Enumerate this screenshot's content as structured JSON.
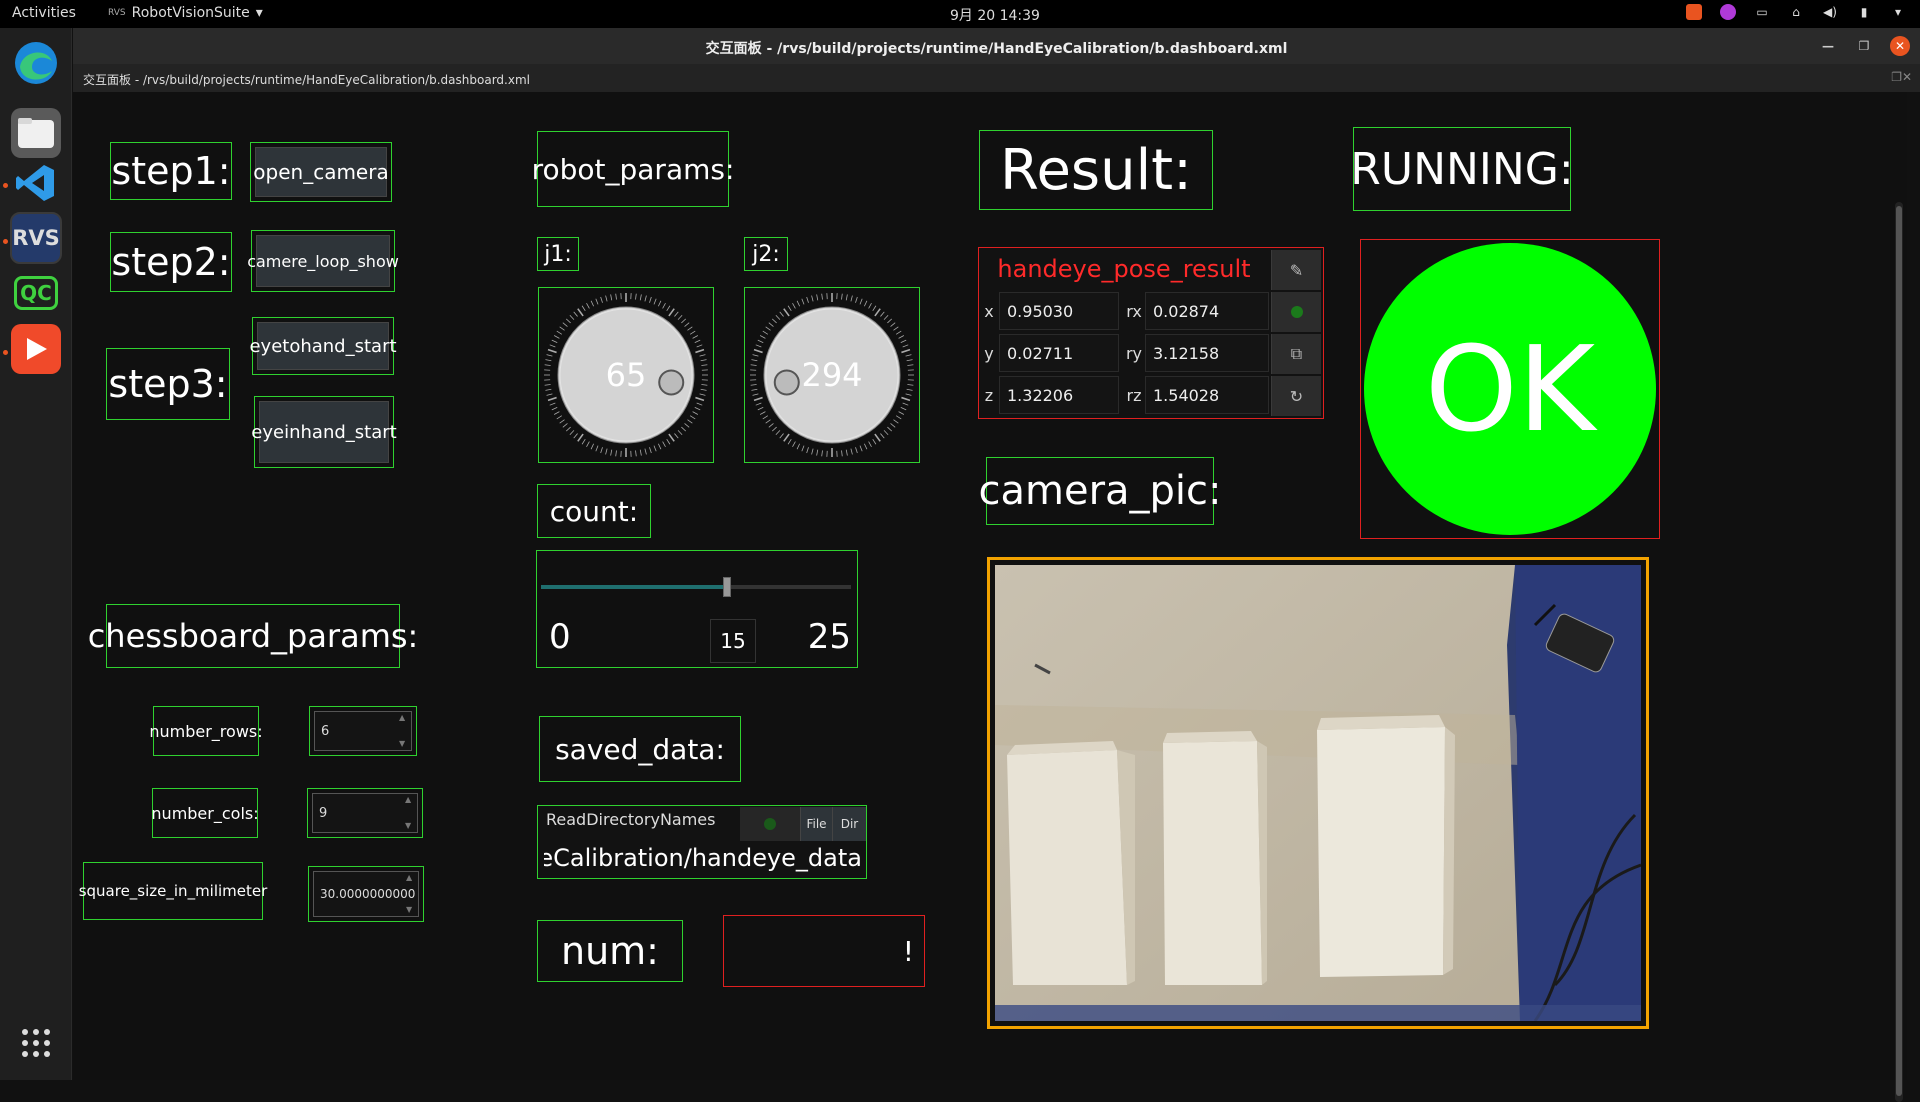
{
  "topbar": {
    "activities": "Activities",
    "app_badge": "RVS",
    "app_name": "RobotVisionSuite",
    "app_caret": "▾",
    "clock": "9月 20  14:39"
  },
  "dock": {
    "apps": [
      "edge",
      "files",
      "vscode",
      "rvs",
      "qc",
      "presenter"
    ],
    "rvs_label": "RVS",
    "qc_label": "QC"
  },
  "window": {
    "title": "交互面板 - /rvs/build/projects/runtime/HandEyeCalibration/b.dashboard.xml",
    "subtitle": "交互面板 - /rvs/build/projects/runtime/HandEyeCalibration/b.dashboard.xml"
  },
  "labels": {
    "step1": "step1:",
    "step2": "step2:",
    "step3": "step3:",
    "robot_params": "robot_params:",
    "result": "Result:",
    "running": "RUNNING:",
    "j1": "j1:",
    "j2": "j2:",
    "count": "count:",
    "chessboard_params": "chessboard_params:",
    "number_rows": "number_rows:",
    "number_cols": "number_cols:",
    "square_size": "square_size_in_milimeter",
    "camera_pic": "camera_pic:",
    "saved_data": "saved_data:",
    "num": "num:"
  },
  "buttons": {
    "open_camera": "open_camera",
    "camere_loop_show": "camere_loop_show",
    "eyetohand_start": "eyetohand_start",
    "eyeinhand_start": "eyeinhand_start"
  },
  "inputs": {
    "number_rows": "6",
    "number_cols": "9",
    "square_size": "30.0000000000"
  },
  "dials": {
    "j1": {
      "value": "65",
      "fraction": 0.18
    },
    "j2": {
      "value": "294",
      "fraction": 0.82
    }
  },
  "count_slider": {
    "min": "0",
    "max": "25",
    "value": "15",
    "fraction": 0.6
  },
  "pose": {
    "title": "handeye_pose_result",
    "x_label": "x",
    "x": "0.95030",
    "y_label": "y",
    "y": "0.02711",
    "z_label": "z",
    "z": "1.32206",
    "rx_label": "rx",
    "rx": "0.02874",
    "ry_label": "ry",
    "ry": "3.12158",
    "rz_label": "rz",
    "rz": "1.54028"
  },
  "status": {
    "ok": "OK",
    "ok_color": "#00ff00"
  },
  "saved_data": {
    "node": "ReadDirectoryNames",
    "file_btn": "File",
    "dir_btn": "Dir",
    "path": "dEyeCalibration/handeye_data"
  },
  "num_value": "!",
  "colors": {
    "accent_border": "#2fd12f",
    "error_border": "#e02020",
    "camera_frame": "#f3a300"
  }
}
